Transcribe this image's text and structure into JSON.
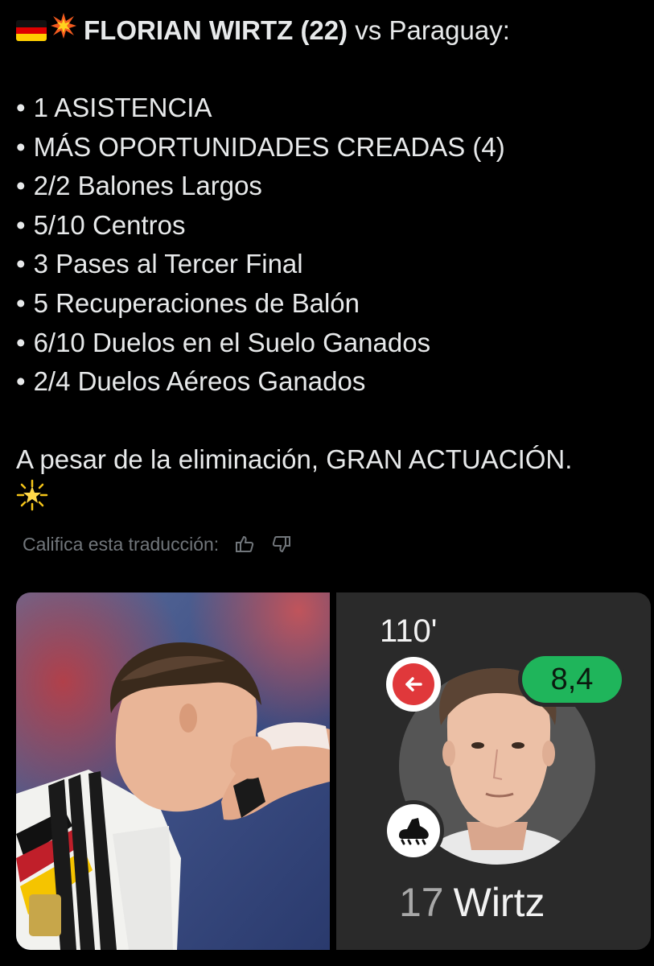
{
  "post": {
    "flag_de": "🇩🇪",
    "headline_emoji": "💥",
    "headline_bold": "FLORIAN WIRTZ (22)",
    "headline_rest": " vs Paraguay:",
    "bullet_char": "•",
    "stats": [
      "1 ASISTENCIA",
      "MÁS OPORTUNIDADES CREADAS (4)",
      "2/2 Balones Largos",
      "5/10 Centros",
      "3 Pases al Tercer Final",
      "5 Recuperaciones de Balón",
      "6/10 Duelos en el Suelo Ganados",
      "2/4 Duelos Aéreos Ganados"
    ],
    "closing": "A pesar de la eliminación, GRAN ACTUACIÓN.",
    "closing_emoji": "🌟"
  },
  "translation": {
    "rate_label": "Califica esta traducción:",
    "thumb_up_icon": "thumbs-up-icon",
    "thumb_down_icon": "thumbs-down-icon"
  },
  "media": {
    "player_card": {
      "minute": "110'",
      "rating": "8,4",
      "shirt_number": "17",
      "player_name": "Wirtz",
      "rating_color": "#1fb55b",
      "sub_color": "#e0383b"
    }
  }
}
